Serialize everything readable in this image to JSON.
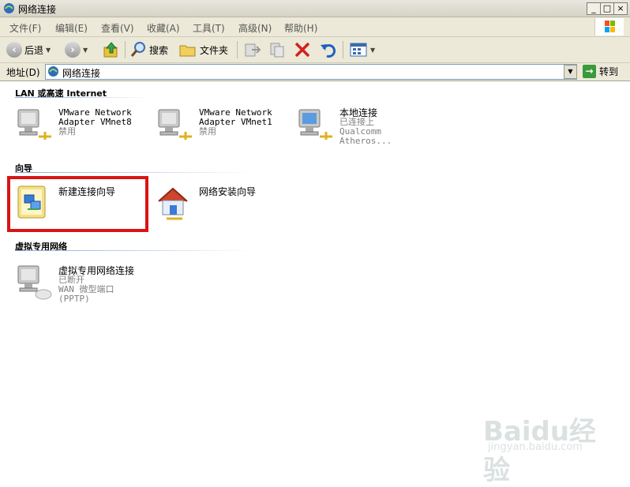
{
  "window": {
    "title": "网络连接",
    "controls": {
      "minimize": "_",
      "maximize": "□",
      "close": "×"
    }
  },
  "menubar": {
    "items": [
      "文件(F)",
      "编辑(E)",
      "查看(V)",
      "收藏(A)",
      "工具(T)",
      "高级(N)",
      "帮助(H)"
    ]
  },
  "toolbar": {
    "back": "后退",
    "search": "搜索",
    "folders": "文件夹"
  },
  "addressbar": {
    "label": "地址(D)",
    "value": "网络连接",
    "go": "转到"
  },
  "groups": [
    {
      "header": "LAN 或高速 Internet",
      "items": [
        {
          "name_lines": [
            "VMware Network",
            "Adapter VMnet8"
          ],
          "status": "禁用"
        },
        {
          "name_lines": [
            "VMware Network",
            "Adapter VMnet1"
          ],
          "status": "禁用"
        },
        {
          "name_lines": [
            "本地连接"
          ],
          "status": "已连接上",
          "device": "Qualcomm Atheros..."
        }
      ]
    },
    {
      "header": "向导",
      "items": [
        {
          "name_lines": [
            "新建连接向导"
          ]
        },
        {
          "name_lines": [
            "网络安装向导"
          ]
        }
      ]
    },
    {
      "header": "虚拟专用网络",
      "items": [
        {
          "name_lines": [
            "虚拟专用网络连接"
          ],
          "status": "已断开",
          "device": "WAN 微型端口 (PPTP)"
        }
      ]
    }
  ],
  "watermark": {
    "brand": "Baidu经验",
    "url": "jingyan.baidu.com"
  },
  "colors": {
    "highlight": "#d91414",
    "chrome": "#ece9d8"
  }
}
